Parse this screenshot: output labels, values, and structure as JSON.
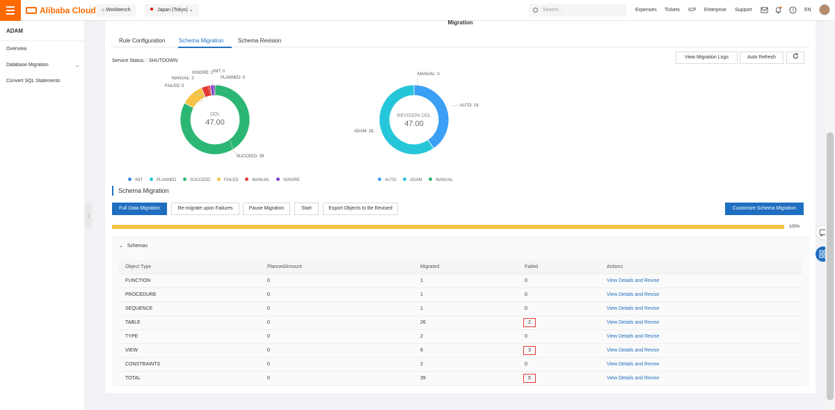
{
  "topbar": {
    "brand": "Alibaba Cloud",
    "workbench": "Workbench",
    "region": "Japan (Tokyo)",
    "search_placeholder": "Search...",
    "links": [
      "Expenses",
      "Tickets",
      "ICP",
      "Enterprise",
      "Support"
    ],
    "language": "EN"
  },
  "sidebar": {
    "title": "ADAM",
    "items": [
      {
        "label": "Overview"
      },
      {
        "label": "Database Migration"
      },
      {
        "label": "Convert SQL Statements"
      }
    ]
  },
  "main": {
    "page_title": "Migration",
    "tabs": [
      {
        "label": "Rule Configuration",
        "active": false
      },
      {
        "label": "Schema Migration",
        "active": true
      },
      {
        "label": "Schema Revision",
        "active": false
      }
    ],
    "service_status": "Service Status: : SHUTDOWN",
    "buttons": {
      "view_logs": "View Migration Logs",
      "auto_refresh": "Auto Refresh"
    },
    "section_title": "Schema Migration",
    "actions": {
      "full_migration": "Full Data Migration",
      "remigrate": "Re-migrate upon Failures",
      "pause": "Pause Migration",
      "start": "Start",
      "export": "Export Objects to Be Revised",
      "customize": "Customize Schema Migration"
    },
    "progress": {
      "value": 1.0,
      "label": "100%"
    },
    "schemas_label": "Schemas",
    "table": {
      "headers": [
        "Object Type",
        "PlannedAmount",
        "Migrated",
        "Failed",
        "Actions"
      ],
      "rows": [
        {
          "type": "FUNCTION",
          "planned": "0",
          "migrated": "1",
          "failed": "0",
          "action": "View Details and Revise",
          "highlight": false
        },
        {
          "type": "PROCEDURE",
          "planned": "0",
          "migrated": "1",
          "failed": "0",
          "action": "View Details and Revise",
          "highlight": false
        },
        {
          "type": "SEQUENCE",
          "planned": "0",
          "migrated": "1",
          "failed": "0",
          "action": "View Details and Revise",
          "highlight": false
        },
        {
          "type": "TABLE",
          "planned": "0",
          "migrated": "26",
          "failed": "2",
          "action": "View Details and Revise",
          "highlight": true
        },
        {
          "type": "TYPE",
          "planned": "0",
          "migrated": "2",
          "failed": "0",
          "action": "View Details and Revise",
          "highlight": false
        },
        {
          "type": "VIEW",
          "planned": "0",
          "migrated": "6",
          "failed": "3",
          "action": "View Details and Revise",
          "highlight": true
        },
        {
          "type": "CONSTRAINTS",
          "planned": "0",
          "migrated": "2",
          "failed": "0",
          "action": "View Details and Revise",
          "highlight": false
        },
        {
          "type": "TOTAL",
          "planned": "0",
          "migrated": "39",
          "failed": "5",
          "action": "View Details and Revise",
          "highlight": true
        }
      ]
    }
  },
  "charts": {
    "ddl": {
      "center_title": "DDL",
      "center_value": "47.00",
      "slices": [
        {
          "name": "INIT",
          "value": 0,
          "color": "#3a8ee6",
          "label": "INIT: 0"
        },
        {
          "name": "PLANNED",
          "value": 0,
          "color": "#26c6da",
          "label": "PLANNED: 0"
        },
        {
          "name": "SUCCEED",
          "value": 39,
          "color": "#2bb673",
          "label": "SUCCEED: 39"
        },
        {
          "name": "FAILED",
          "value": 5,
          "color": "#f5c242",
          "label": "FAILED: 5"
        },
        {
          "name": "MANUAL",
          "value": 2,
          "color": "#e53935",
          "label": "MANUAL: 2"
        },
        {
          "name": "IGNORE",
          "value": 1,
          "color": "#7e3ec9",
          "label": "IGNORE: 1"
        }
      ]
    },
    "revision": {
      "center_title": "REVISION DDL",
      "center_value": "47.00",
      "slices": [
        {
          "name": "AUTO",
          "value": 19,
          "color": "#3a9ff5",
          "label": "AUTO: 19"
        },
        {
          "name": "ADAM",
          "value": 28,
          "color": "#26c6da",
          "label": "ADAM: 28"
        },
        {
          "name": "MANUAL",
          "value": 0,
          "color": "#2bb673",
          "label": "MANUAL: 0"
        }
      ]
    }
  }
}
